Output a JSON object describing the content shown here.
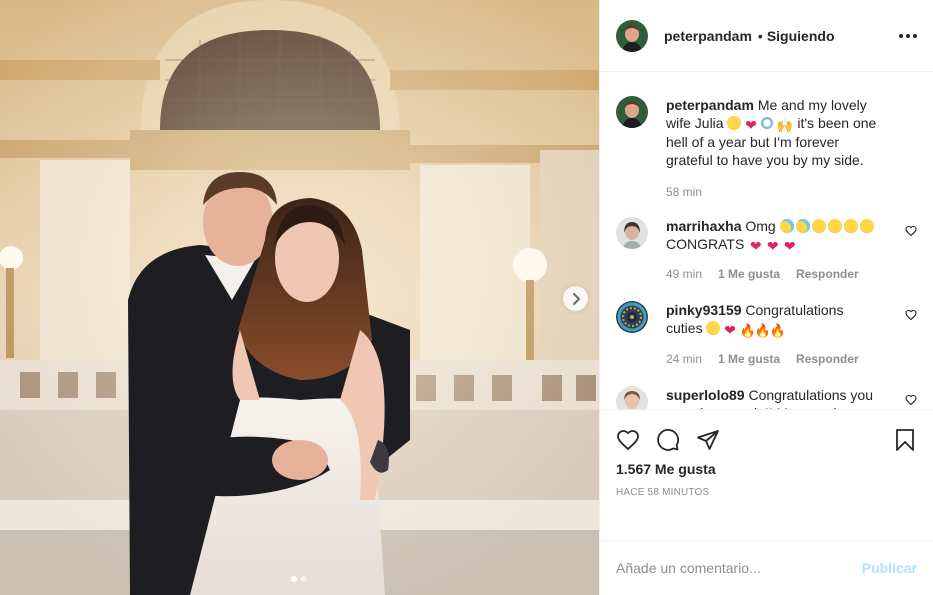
{
  "post": {
    "author": "peterpandam",
    "separator": "•",
    "follow_status": "Siguiendo",
    "more_icon": "more-horizontal-icon",
    "photo": {
      "carousel_dots": 2,
      "active_dot": 0,
      "next_icon": "chevron-right-icon"
    }
  },
  "caption": {
    "username": "peterpandam",
    "text_before": "Me and my lovely wife Julia",
    "emojis": [
      "smiling-face-with-hearts",
      "red-heart",
      "ring",
      "raising-hands"
    ],
    "text_after": "it's been one hell of a year but I'm forever grateful to have you by my side.",
    "time": "58 min"
  },
  "comments": [
    {
      "username": "marrihaxha",
      "text_before": "Omg",
      "emojis_before": [
        "crying-face",
        "crying-face",
        "smiling-face-with-hearts",
        "smiling-face-with-hearts",
        "smiling-face-with-hearts",
        "smiling-face-with-hearts"
      ],
      "text_after": "CONGRATS",
      "emojis_after": [
        "red-heart",
        "red-heart",
        "red-heart"
      ],
      "time": "49 min",
      "likes": "1 Me gusta",
      "reply": "Responder"
    },
    {
      "username": "pinky93159",
      "text_before": "Congratulations cuties",
      "emojis_before": [
        "smiling-face-with-heart-eyes",
        "red-heart",
        "fire",
        "fire",
        "fire"
      ],
      "text_after": "",
      "emojis_after": [],
      "time": "24 min",
      "likes": "1 Me gusta",
      "reply": "Responder"
    },
    {
      "username": "superlolo89",
      "text_before": "Congratulations you amazing people!! May you be blessed with tons of love and",
      "emojis_before": [],
      "text_after": "",
      "emojis_after": [],
      "time": "",
      "likes": "",
      "reply": ""
    }
  ],
  "actions": {
    "like_icon": "heart-icon",
    "comment_icon": "comment-bubble-icon",
    "share_icon": "paper-plane-icon",
    "save_icon": "bookmark-icon",
    "likes_count": "1.567 Me gusta",
    "time_ago": "HACE 58 MINUTOS"
  },
  "add_comment": {
    "placeholder": "Añade un comentario...",
    "publish_label": "Publicar"
  },
  "colors": {
    "text": "#262626",
    "muted": "#8e8e8e",
    "border": "#efefef",
    "publish_disabled": "#b2dffc"
  }
}
